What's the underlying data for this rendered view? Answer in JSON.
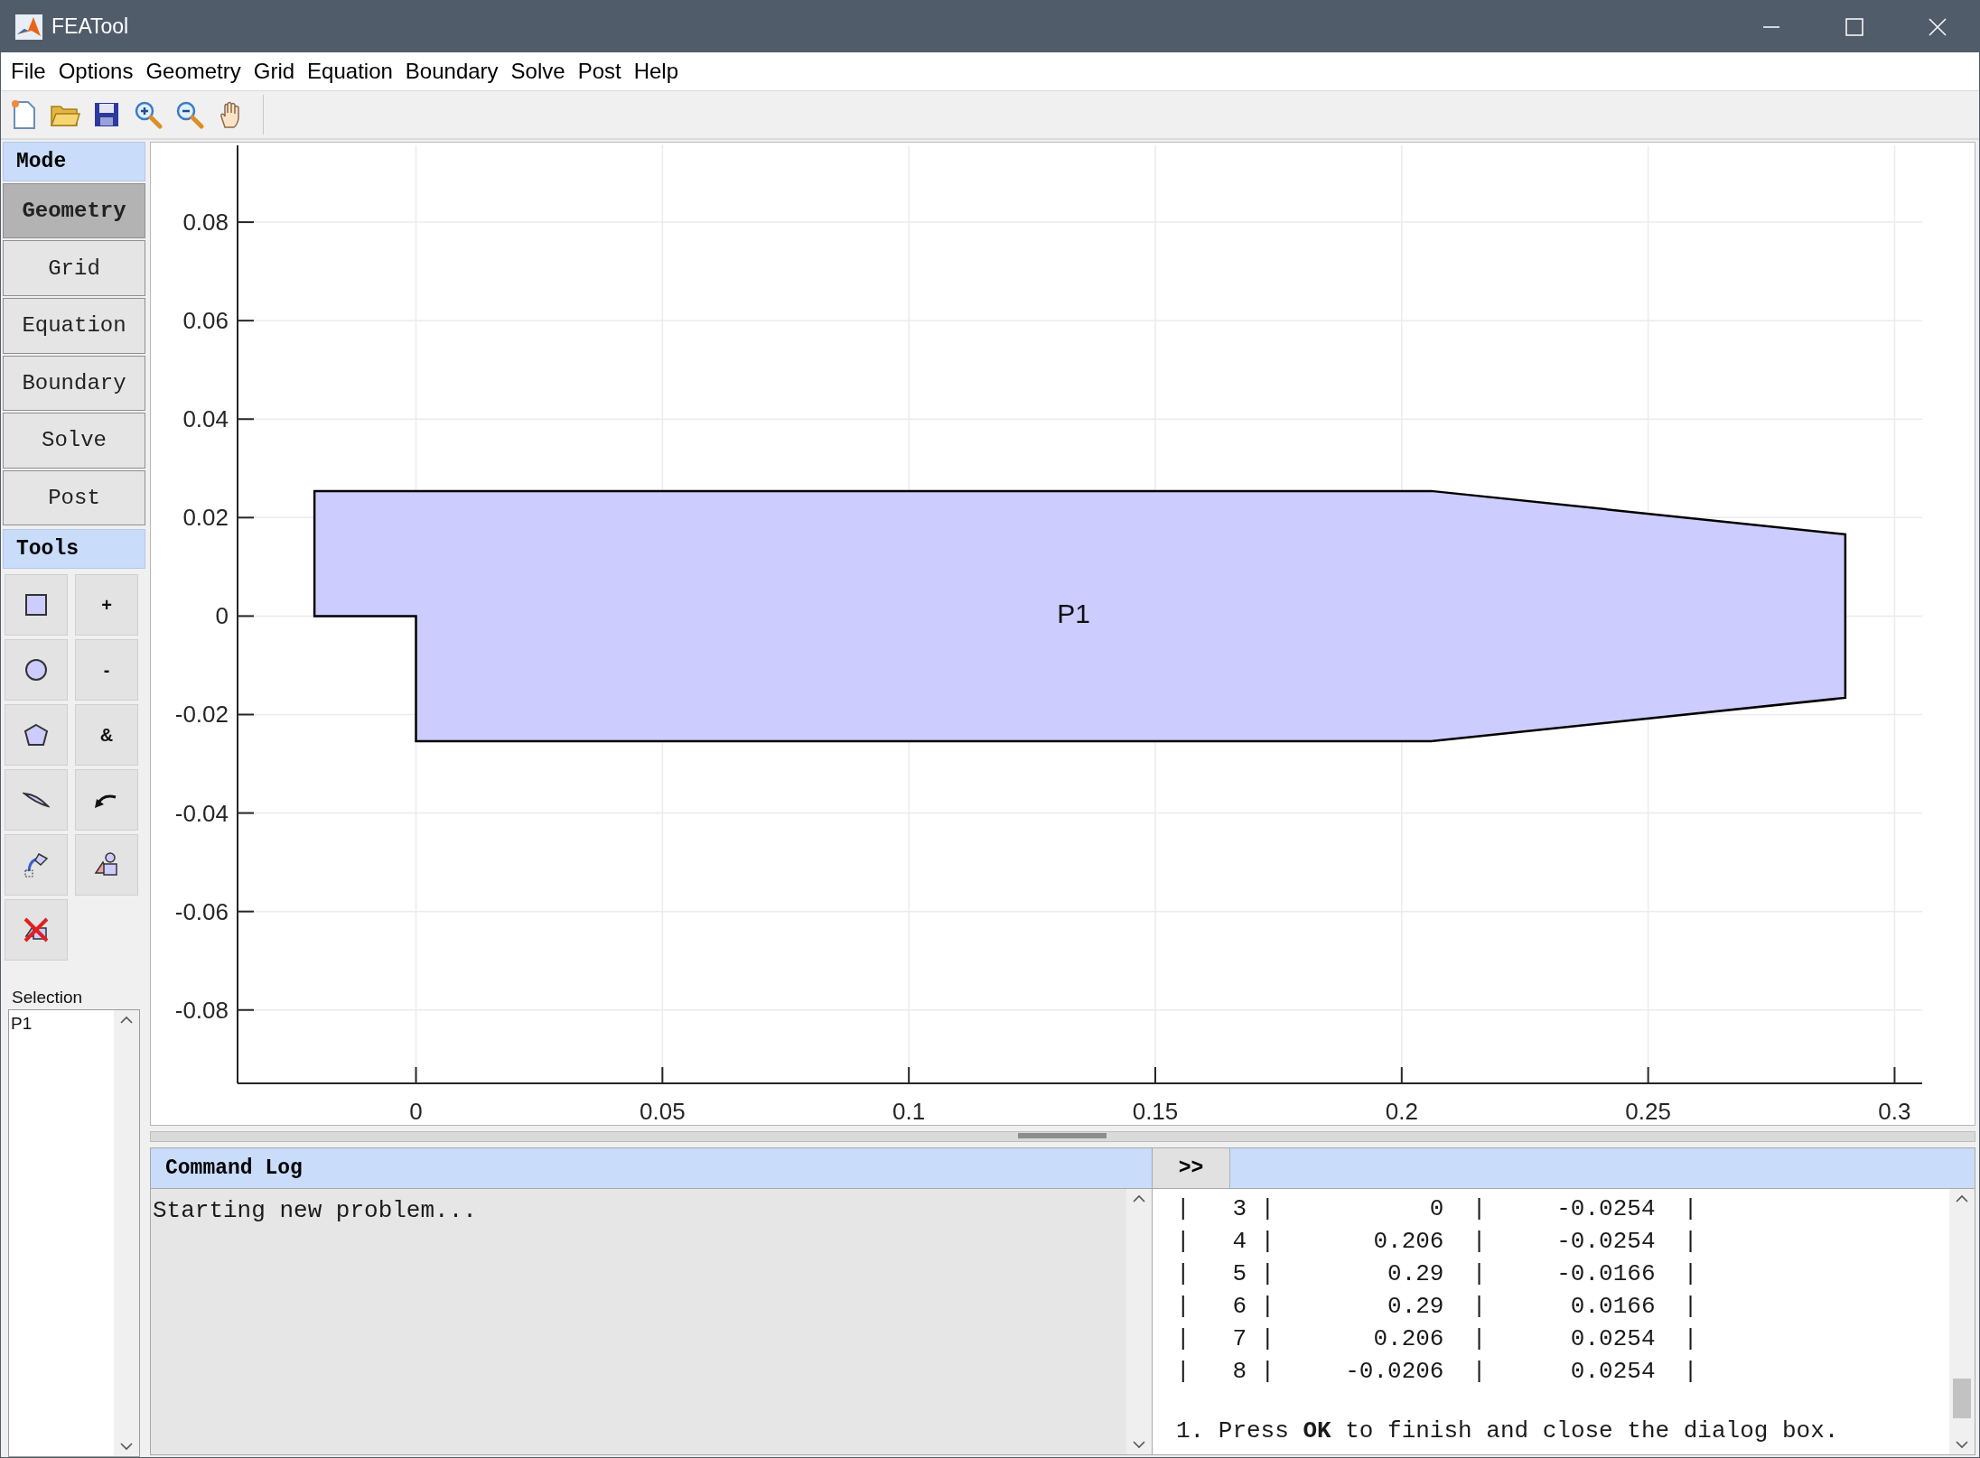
{
  "window": {
    "title": "FEATool"
  },
  "menu": [
    "File",
    "Options",
    "Geometry",
    "Grid",
    "Equation",
    "Boundary",
    "Solve",
    "Post",
    "Help"
  ],
  "mode_panel": {
    "title": "Mode",
    "items": [
      {
        "label": "Geometry",
        "selected": true
      },
      {
        "label": "Grid",
        "selected": false
      },
      {
        "label": "Equation",
        "selected": false
      },
      {
        "label": "Boundary",
        "selected": false
      },
      {
        "label": "Solve",
        "selected": false
      },
      {
        "label": "Post",
        "selected": false
      }
    ]
  },
  "tools_panel": {
    "title": "Tools",
    "tools": [
      {
        "kind": "rectangle"
      },
      {
        "kind": "text",
        "label": "+"
      },
      {
        "kind": "circle"
      },
      {
        "kind": "text",
        "label": "-"
      },
      {
        "kind": "polygon"
      },
      {
        "kind": "text",
        "label": "&"
      },
      {
        "kind": "line"
      },
      {
        "kind": "undo"
      },
      {
        "kind": "transform"
      },
      {
        "kind": "shapes"
      },
      {
        "kind": "delete"
      }
    ]
  },
  "selection": {
    "label": "Selection",
    "items": [
      "P1"
    ]
  },
  "plot": {
    "chart_data": {
      "type": "area",
      "x": [
        -0.0206,
        0,
        0,
        0.206,
        0.29,
        0.29,
        0.206,
        -0.0206
      ],
      "series": [
        {
          "name": "P1",
          "color": "#ccccff",
          "values": [
            0,
            0,
            -0.0254,
            -0.0254,
            -0.0166,
            0.0166,
            0.0254,
            0.0254
          ]
        }
      ],
      "xlim": [
        -0.0362,
        0.3056
      ],
      "ylim": [
        -0.0949,
        0.0956
      ],
      "xticks": [
        0,
        0.05,
        0.1,
        0.15,
        0.2,
        0.25,
        0.3
      ],
      "yticks": [
        -0.08,
        -0.06,
        -0.04,
        -0.02,
        0,
        0.02,
        0.04,
        0.06,
        0.08
      ],
      "grid": true
    }
  },
  "command_log": {
    "title": "Command Log",
    "lines": [
      "Starting new problem..."
    ]
  },
  "output": {
    "toggle": ">>",
    "lines": [
      "|   3 |           0  |     -0.0254  |",
      "|   4 |       0.206  |     -0.0254  |",
      "|   5 |        0.29  |     -0.0166  |",
      "|   6 |        0.29  |      0.0166  |",
      "|   7 |       0.206  |      0.0254  |",
      "|   8 |     -0.0206  |      0.0254  |"
    ],
    "message": "1. Press **OK** to finish and close the dialog box."
  }
}
